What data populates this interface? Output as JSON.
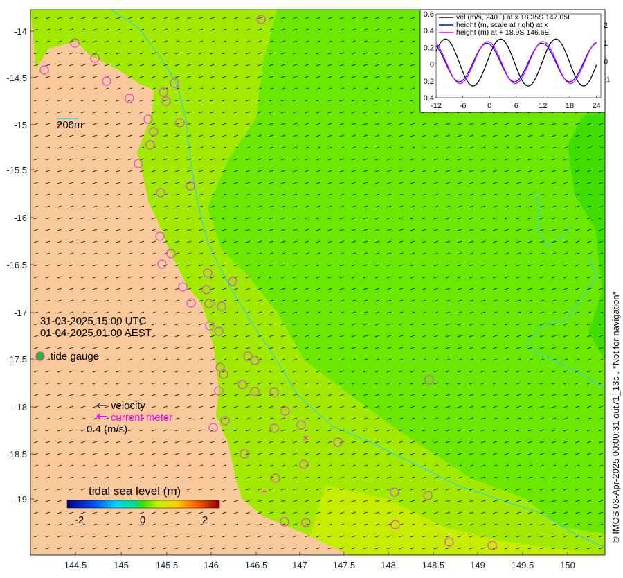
{
  "map": {
    "x_ticks": [
      "144.5",
      "145",
      "145.5",
      "146",
      "146.5",
      "147",
      "147.5",
      "148",
      "148.5",
      "149",
      "149.5",
      "150"
    ],
    "y_ticks": [
      "-14",
      "-14.5",
      "-15",
      "-15.5",
      "-16",
      "-16.5",
      "-17",
      "-17.5",
      "-18",
      "-18.5",
      "-19"
    ],
    "scale_label": "200m",
    "timestamp_utc": "31-03-2025 15:00 UTC",
    "timestamp_aest": "01-04-2025 01:00 AEST",
    "tide_gauge_label": "tide gauge",
    "velocity_label": "velocity",
    "current_meter_label": "current meter",
    "velocity_scale_label": "0.4 (m/s)",
    "colorbar_title": "tidal sea level (m)",
    "colorbar_ticks": [
      "-2",
      "0",
      "2"
    ],
    "side_note": "© IMOS 03-Apr-2025 00:00:31 out71_13c . *Not for navigation*",
    "colors": {
      "land": "#f9c99b",
      "sea_main": "#6ae800",
      "sea_coast": "#a2ea00",
      "sea_deep": "#3fe000",
      "isobath": "#33d6d6",
      "gauge": "#e040e0",
      "current_meter": "#ff00ff"
    }
  },
  "chart_data": {
    "type": "line",
    "x_ticks": [
      "-12",
      "-6",
      "0",
      "6",
      "12",
      "18",
      "24"
    ],
    "y_left_ticks": [
      "0.6",
      "0.4",
      "0.2",
      "0",
      "0.2",
      "0.4"
    ],
    "y_right_ticks": [
      "2",
      "1",
      "0",
      "-1"
    ],
    "xlim": [
      -12,
      25
    ],
    "ylim_left": [
      -0.4,
      0.6
    ],
    "ylim_right": [
      -2,
      2.6
    ],
    "series": [
      {
        "name": "vel (m/s, 240T) at x 18.35S 147.05E",
        "color": "#000000",
        "amplitude": 0.28,
        "period": 12.4,
        "phase": 2.5
      },
      {
        "name": "height (m, scale at right) at x",
        "color": "#0000ff",
        "amplitude": 0.23,
        "period": 12.4,
        "phase": -0.6
      },
      {
        "name": "height (m) at + 18.9S 146.6E",
        "color": "#e000e0",
        "amplitude": 0.25,
        "period": 12.4,
        "phase": -0.4
      }
    ]
  }
}
